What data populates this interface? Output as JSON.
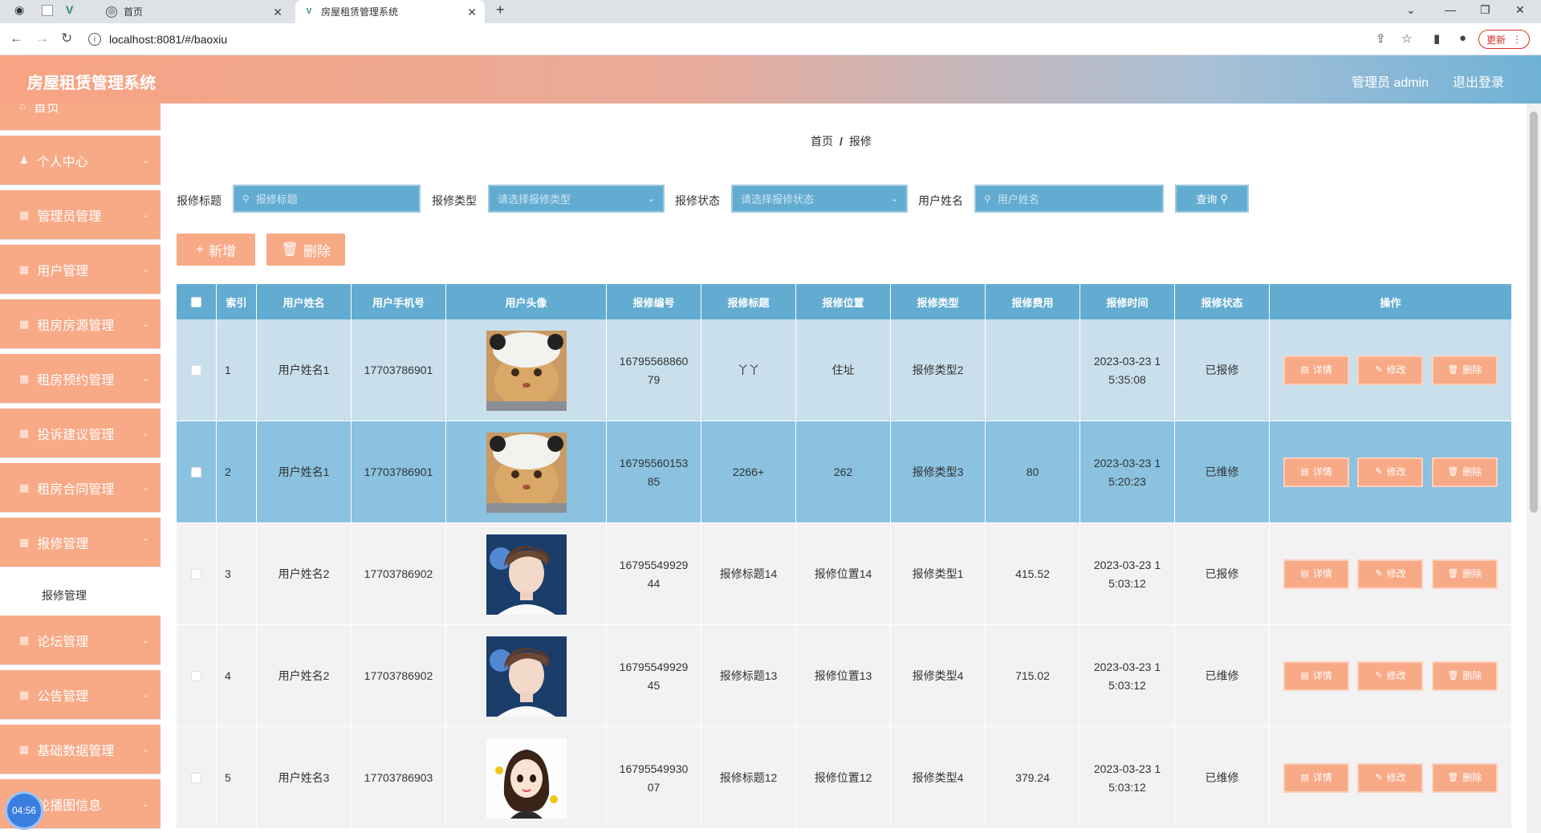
{
  "browser": {
    "tabs": [
      {
        "label": "首页",
        "active": false
      },
      {
        "label": "房屋租赁管理系统",
        "active": true
      }
    ],
    "url": "localhost:8081/#/baoxiu",
    "update_label": "更新"
  },
  "header": {
    "title": "房屋租赁管理系统",
    "admin_label": "管理员 admin",
    "logout_label": "退出登录"
  },
  "sidebar": {
    "items": [
      {
        "label": "首页"
      },
      {
        "label": "个人中心"
      },
      {
        "label": "管理员管理"
      },
      {
        "label": "用户管理"
      },
      {
        "label": "租房房源管理"
      },
      {
        "label": "租房预约管理"
      },
      {
        "label": "投诉建议管理"
      },
      {
        "label": "租房合同管理"
      },
      {
        "label": "报修管理"
      },
      {
        "label": "论坛管理"
      },
      {
        "label": "公告管理"
      },
      {
        "label": "基础数据管理"
      },
      {
        "label": "轮播图信息"
      }
    ],
    "sub_item": "报修管理",
    "timer": "04:56"
  },
  "breadcrumb": {
    "home": "首页",
    "separator": "/",
    "current": "报修"
  },
  "filters": {
    "title_label": "报修标题",
    "title_placeholder": "报修标题",
    "type_label": "报修类型",
    "type_placeholder": "请选择报修类型",
    "status_label": "报修状态",
    "status_placeholder": "请选择报修状态",
    "username_label": "用户姓名",
    "username_placeholder": "用户姓名",
    "query_label": "查询"
  },
  "actions": {
    "add_label": "新增",
    "delete_label": "删除"
  },
  "table": {
    "headers": [
      "索引",
      "用户姓名",
      "用户手机号",
      "用户头像",
      "报修编号",
      "报修标题",
      "报修位置",
      "报修类型",
      "报修费用",
      "报修时间",
      "报修状态",
      "操作"
    ],
    "rows": [
      {
        "index": "1",
        "name": "用户姓名1",
        "phone": "17703786901",
        "avatar": "cat",
        "code_line1": "16795568860",
        "code_line2": "79",
        "title": "丫丫",
        "location": "住址",
        "type": "报修类型2",
        "fee": "",
        "time_line1": "2023-03-23 1",
        "time_line2": "5:35:08",
        "status": "已报修"
      },
      {
        "index": "2",
        "name": "用户姓名1",
        "phone": "17703786901",
        "avatar": "cat",
        "code_line1": "16795560153",
        "code_line2": "85",
        "title": "2266+",
        "location": "262",
        "type": "报修类型3",
        "fee": "80",
        "time_line1": "2023-03-23 1",
        "time_line2": "5:20:23",
        "status": "已维修"
      },
      {
        "index": "3",
        "name": "用户姓名2",
        "phone": "17703786902",
        "avatar": "boy",
        "code_line1": "16795549929",
        "code_line2": "44",
        "title": "报修标题14",
        "location": "报修位置14",
        "type": "报修类型1",
        "fee": "415.52",
        "time_line1": "2023-03-23 1",
        "time_line2": "5:03:12",
        "status": "已报修"
      },
      {
        "index": "4",
        "name": "用户姓名2",
        "phone": "17703786902",
        "avatar": "boy",
        "code_line1": "16795549929",
        "code_line2": "45",
        "title": "报修标题13",
        "location": "报修位置13",
        "type": "报修类型4",
        "fee": "715.02",
        "time_line1": "2023-03-23 1",
        "time_line2": "5:03:12",
        "status": "已维修"
      },
      {
        "index": "5",
        "name": "用户姓名3",
        "phone": "17703786903",
        "avatar": "girl",
        "code_line1": "16795549930",
        "code_line2": "07",
        "title": "报修标题12",
        "location": "报修位置12",
        "type": "报修类型4",
        "fee": "379.24",
        "time_line1": "2023-03-23 1",
        "time_line2": "5:03:12",
        "status": "已维修"
      }
    ],
    "op_labels": {
      "detail": "详情",
      "edit": "修改",
      "delete": "删除"
    }
  },
  "colors": {
    "accent": "#f8a986",
    "table_header": "#63acd1",
    "row_light": "#c9e0ec",
    "row_selected": "#8ac2df",
    "row_plain": "#f2f2f2"
  }
}
